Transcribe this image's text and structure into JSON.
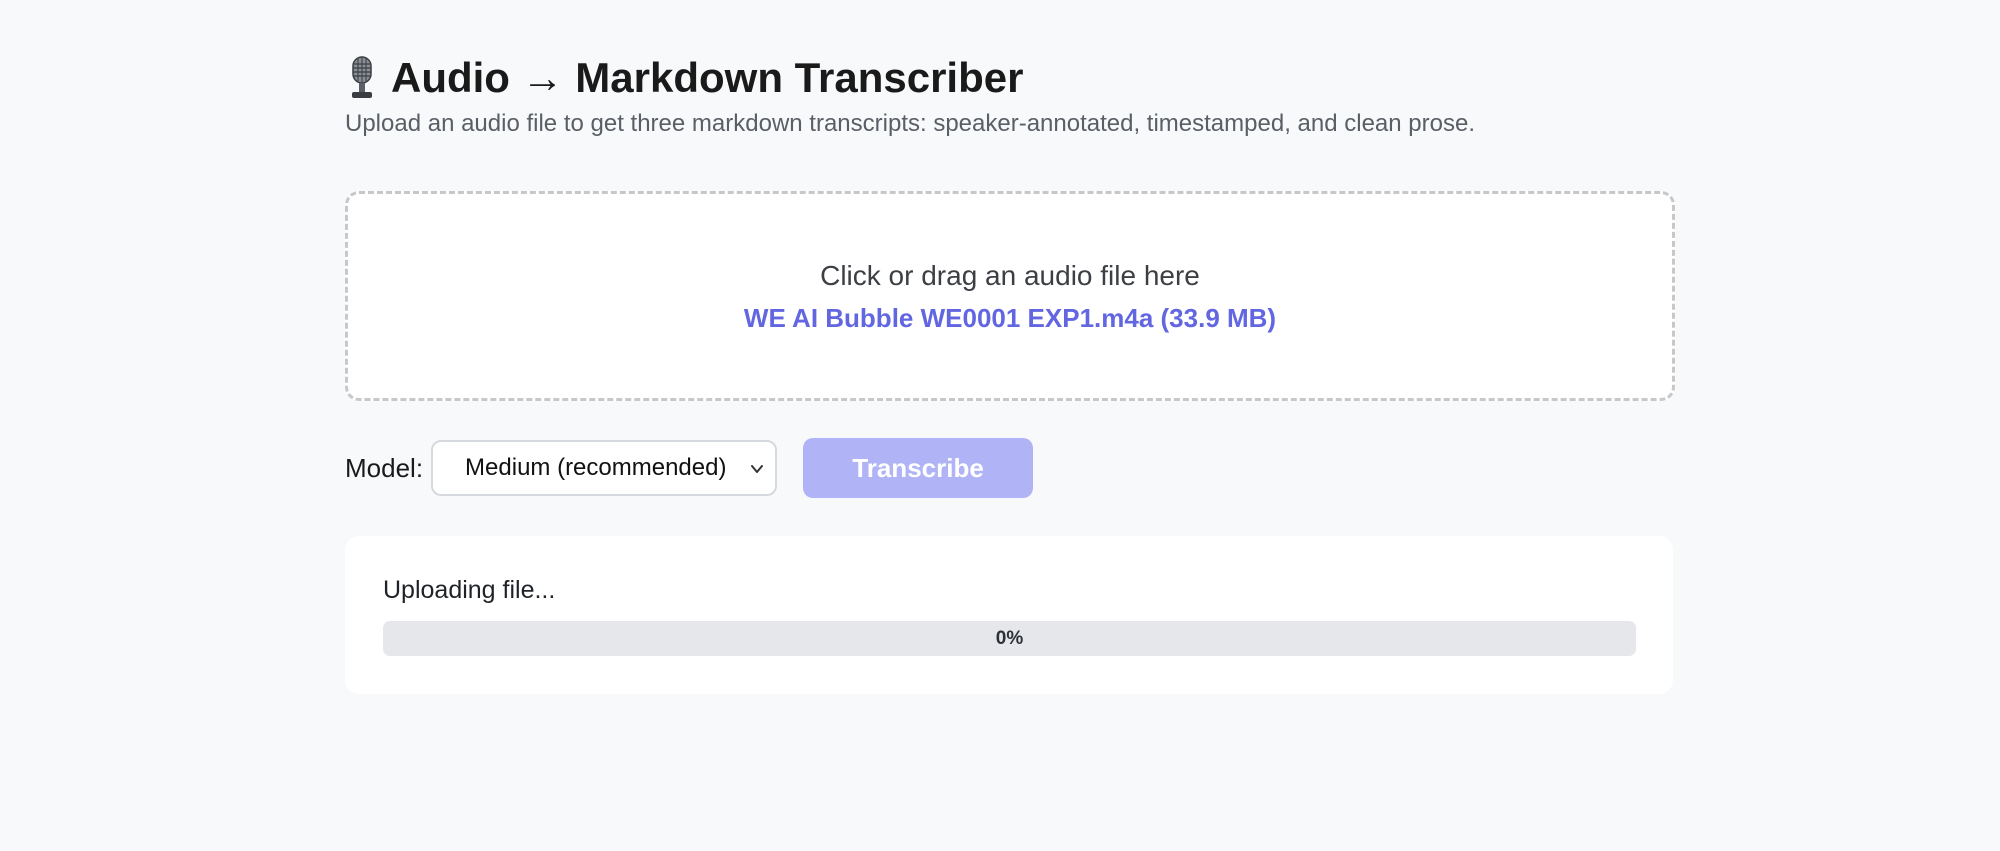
{
  "header": {
    "title": "Audio → Markdown Transcriber",
    "title_icon": "microphone-icon",
    "subtitle": "Upload an audio file to get three markdown transcripts: speaker-annotated, timestamped, and clean prose."
  },
  "dropzone": {
    "prompt": "Click or drag an audio file here",
    "selected_file": "WE AI Bubble WE0001 EXP1.m4a (33.9 MB)"
  },
  "controls": {
    "model_label": "Model:",
    "model_selected": "Medium (recommended)",
    "transcribe_label": "Transcribe"
  },
  "progress": {
    "status": "Uploading file...",
    "percent_text": "0%",
    "value": 0
  },
  "colors": {
    "accent": "#6366e1",
    "button_disabled": "#b0b3f6",
    "track": "#e5e7eb"
  }
}
